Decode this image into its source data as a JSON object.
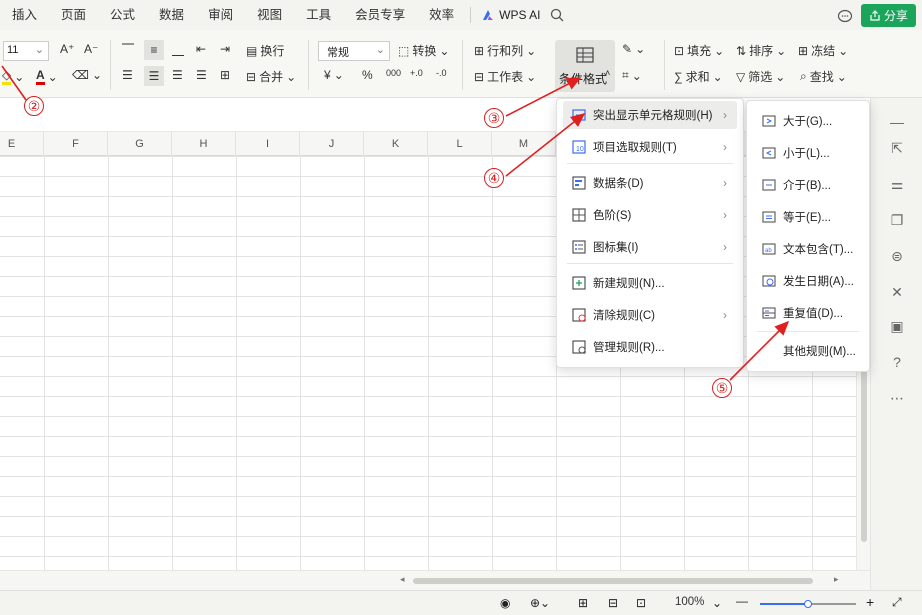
{
  "menubar": {
    "tabs": [
      "插入",
      "页面",
      "公式",
      "数据",
      "审阅",
      "视图",
      "工具",
      "会员专享",
      "效率"
    ],
    "wps_ai": "WPS AI",
    "share": "分享"
  },
  "ribbon": {
    "font_size": "11",
    "wrap": "换行",
    "merge": "合并",
    "number_format": "常规",
    "convert": "转换",
    "currency_symbol": "¥",
    "percent_symbol": "%",
    "thousands_symbol": "000",
    "inc_decimal_symbol": "+.0",
    "dec_decimal_symbol": "-.0",
    "row_col": "行和列",
    "worksheet": "工作表",
    "conditional_format": "条件格式",
    "fill": "填充",
    "sort": "排序",
    "freeze": "冻结",
    "sum": "求和",
    "filter": "筛选",
    "find": "查找"
  },
  "columns": [
    "E",
    "F",
    "G",
    "H",
    "I",
    "J",
    "K",
    "L",
    "M"
  ],
  "menu_main": [
    {
      "label": "突出显示单元格规则(H)",
      "icon": "highlight-rules-icon",
      "submenu": true
    },
    {
      "label": "项目选取规则(T)",
      "icon": "top-bottom-icon",
      "submenu": true
    },
    {
      "label": "数据条(D)",
      "icon": "data-bar-icon",
      "submenu": true
    },
    {
      "label": "色阶(S)",
      "icon": "color-scale-icon",
      "submenu": true
    },
    {
      "label": "图标集(I)",
      "icon": "icon-set-icon",
      "submenu": true
    },
    {
      "label": "新建规则(N)...",
      "icon": "new-rule-icon",
      "submenu": false
    },
    {
      "label": "清除规则(C)",
      "icon": "clear-rules-icon",
      "submenu": true
    },
    {
      "label": "管理规则(R)...",
      "icon": "manage-rules-icon",
      "submenu": false
    }
  ],
  "menu_sub": [
    {
      "label": "大于(G)...",
      "icon": "greater-than-icon"
    },
    {
      "label": "小于(L)...",
      "icon": "less-than-icon"
    },
    {
      "label": "介于(B)...",
      "icon": "between-icon"
    },
    {
      "label": "等于(E)...",
      "icon": "equal-to-icon"
    },
    {
      "label": "文本包含(T)...",
      "icon": "text-contains-icon"
    },
    {
      "label": "发生日期(A)...",
      "icon": "date-occurring-icon"
    },
    {
      "label": "重复值(D)...",
      "icon": "duplicate-values-icon"
    },
    {
      "label": "其他规则(M)...",
      "icon": ""
    }
  ],
  "callouts": {
    "c2": "②",
    "c3": "③",
    "c4": "④",
    "c5": "⑤"
  },
  "status": {
    "zoom": "100%",
    "zoom_in": "+",
    "zoom_out": "—"
  },
  "colors": {
    "accent_green": "#1aa55a",
    "callout_red": "#d42020"
  }
}
